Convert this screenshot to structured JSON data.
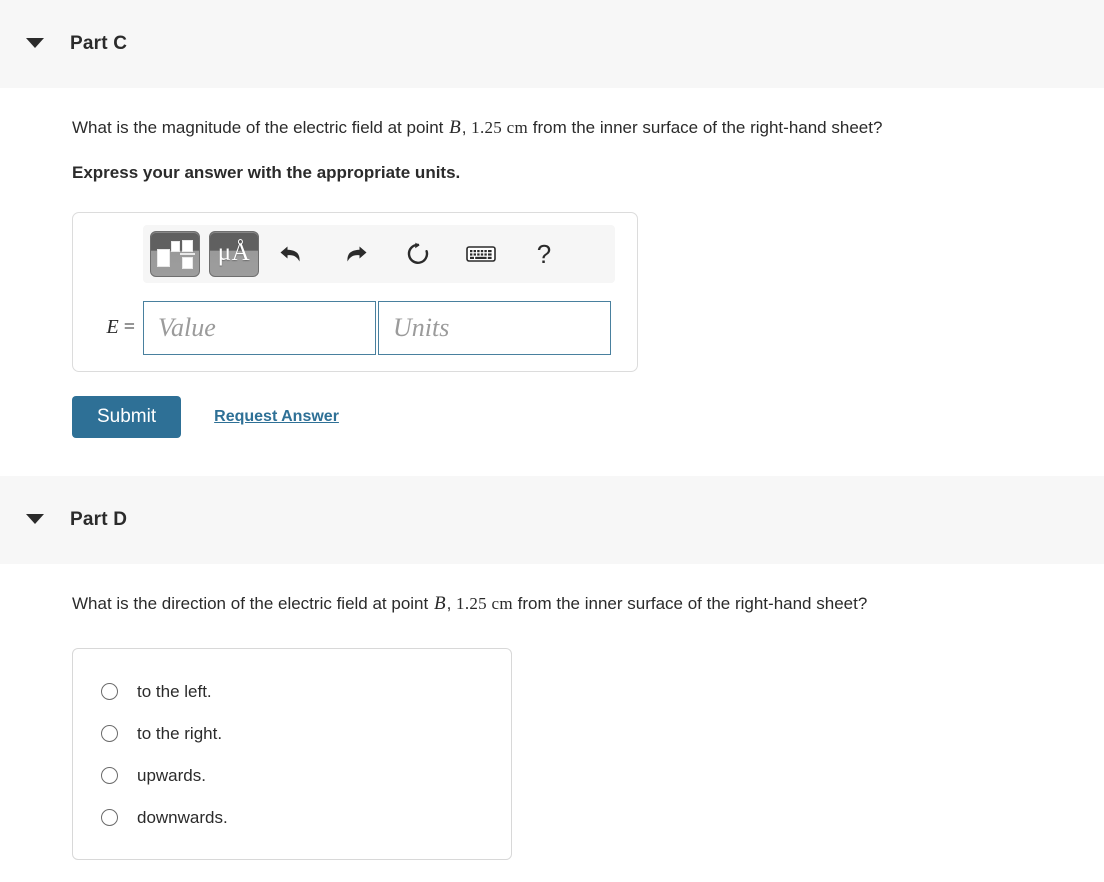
{
  "part_c": {
    "title": "Part C",
    "caret_icon": "chevron-down-icon",
    "question_prefix": "What is the magnitude of the electric field at point ",
    "question_var": "B",
    "question_mid": ", ",
    "question_distance": "1.25 cm",
    "question_suffix": " from the inner surface of the right-hand sheet?",
    "instruction": "Express your answer with the appropriate units.",
    "toolbar": {
      "template_button_name": "math-template-icon",
      "units_button_label": "μÅ",
      "undo_name": "undo-icon",
      "redo_name": "redo-icon",
      "reset_name": "reset-icon",
      "keyboard_name": "keyboard-icon",
      "help_label": "?"
    },
    "answer": {
      "label_var": "E",
      "label_eq": " =",
      "value_placeholder": "Value",
      "value_text": "",
      "units_placeholder": "Units",
      "units_text": ""
    },
    "submit_label": "Submit",
    "request_answer_label": "Request Answer"
  },
  "part_d": {
    "title": "Part D",
    "caret_icon": "chevron-down-icon",
    "question_prefix": "What is the direction of the electric field at point ",
    "question_var": "B",
    "question_mid": ", ",
    "question_distance": "1.25 cm",
    "question_suffix": " from the inner surface of the right-hand sheet?",
    "options": [
      {
        "label": "to the left."
      },
      {
        "label": "to the right."
      },
      {
        "label": "upwards."
      },
      {
        "label": "downwards."
      }
    ]
  },
  "colors": {
    "accent": "#2e7096",
    "header_bg": "#f7f7f7",
    "field_border": "#49809e",
    "text": "#2b2b2b"
  }
}
